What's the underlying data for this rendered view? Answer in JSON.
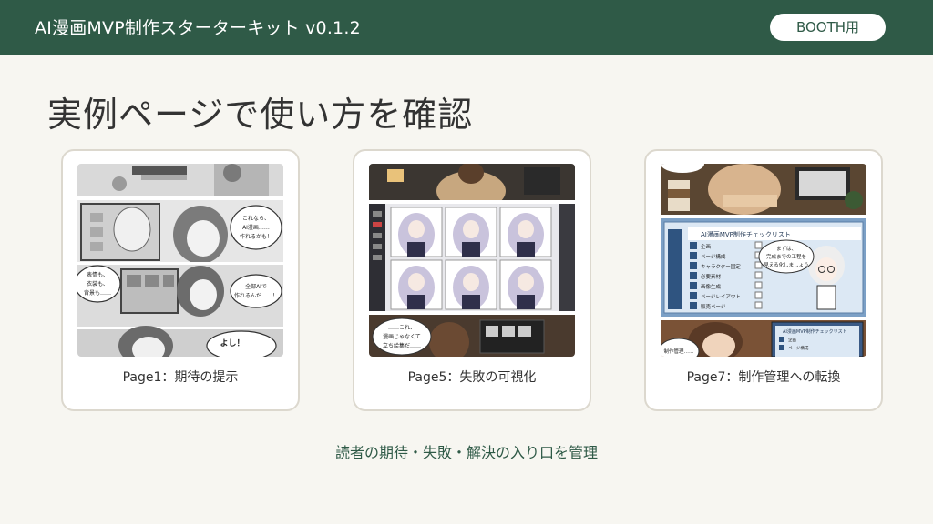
{
  "header": {
    "title": "AI漫画MVP制作スターターキット v0.1.2",
    "badge": "BOOTH用"
  },
  "main": {
    "title": "実例ページで使い方を確認",
    "cards": [
      {
        "caption": "Page1：期待の提示",
        "bubbles": [
          "これなら、",
          "AI漫画……",
          "作れるかも！",
          "表情も、",
          "衣装も、",
          "背景も……",
          "全部AIで",
          "作れるんだ……！",
          "よし！"
        ]
      },
      {
        "caption": "Page5：失敗の可視化",
        "bubbles": [
          "……これ、",
          "漫画じゃなくて",
          "立ち絵集だ……"
        ]
      },
      {
        "caption": "Page7：制作管理への転換",
        "checklist_title": "AI漫画MVP制作チェックリスト",
        "checklist_items": [
          "企画",
          "ページ構成",
          "キャラクター固定",
          "必要素材",
          "画像生成",
          "ページレイアウト",
          "販売ページ"
        ],
        "bubbles": [
          "まずは、",
          "完成までの工程を",
          "見える化しましょう"
        ],
        "small_label": "制作管理……",
        "mini_title": "AI漫画MVP制作チェックリスト",
        "mini_items": [
          "企画",
          "ページ構成"
        ]
      }
    ]
  },
  "footer": {
    "note": "読者の期待・失敗・解決の入り口を管理"
  },
  "colors": {
    "header_bg": "#2f5a47",
    "page_bg": "#f7f6f1",
    "card_border": "#dcd8ce"
  }
}
